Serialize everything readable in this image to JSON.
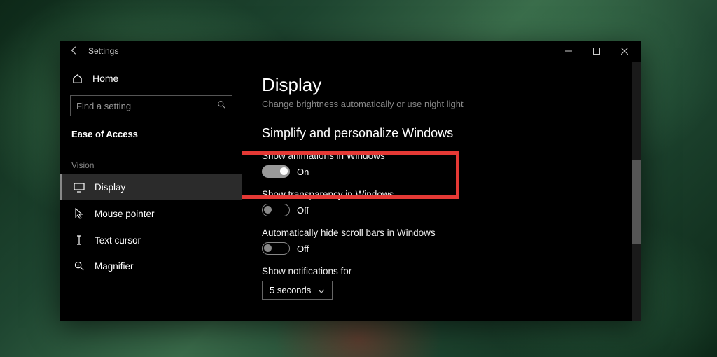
{
  "titlebar": {
    "app": "Settings"
  },
  "sidebar": {
    "home": "Home",
    "search_placeholder": "Find a setting",
    "category": "Ease of Access",
    "group": "Vision",
    "items": [
      {
        "label": "Display",
        "active": true
      },
      {
        "label": "Mouse pointer",
        "active": false
      },
      {
        "label": "Text cursor",
        "active": false
      },
      {
        "label": "Magnifier",
        "active": false
      }
    ]
  },
  "content": {
    "heading": "Display",
    "subheading": "Change brightness automatically or use night light",
    "section": "Simplify and personalize Windows",
    "settings": {
      "animations": {
        "label": "Show animations in Windows",
        "state": "On",
        "on": true
      },
      "transparency": {
        "label": "Show transparency in Windows",
        "state": "Off",
        "on": false
      },
      "scrollbars": {
        "label": "Automatically hide scroll bars in Windows",
        "state": "Off",
        "on": false
      },
      "notifications": {
        "label": "Show notifications for",
        "value": "5 seconds"
      }
    }
  }
}
